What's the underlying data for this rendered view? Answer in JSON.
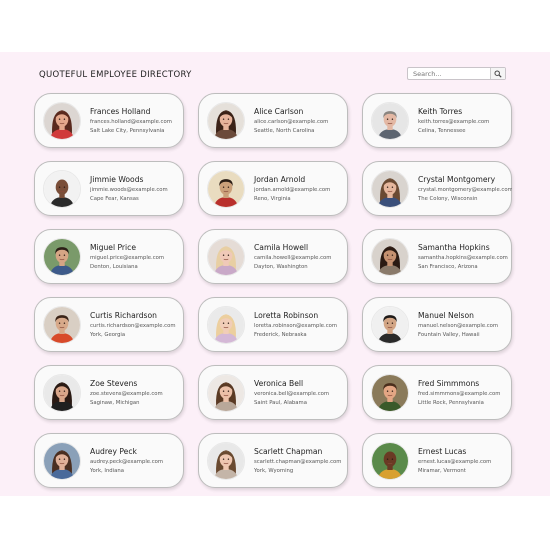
{
  "header": {
    "title": "QUOTEFUL EMPLOYEE DIRECTORY",
    "search_placeholder": "Search..."
  },
  "employees": [
    {
      "name": "Frances Holland",
      "email": "frances.holland@example.com",
      "location": "Salt Lake City, Pennsylvania",
      "skin": "#e4a88c",
      "hair": "#5a2a1e",
      "shirt": "#d03a3a",
      "bg": "#dcd6d2",
      "hairStyle": "long"
    },
    {
      "name": "Alice Carlson",
      "email": "alice.carlson@example.com",
      "location": "Seattle, North Carolina",
      "skin": "#e7b49c",
      "hair": "#3b2217",
      "shirt": "#6b4a3a",
      "bg": "#e5e0da",
      "hairStyle": "long"
    },
    {
      "name": "Keith Torres",
      "email": "keith.torres@example.com",
      "location": "Celina, Tennessee",
      "skin": "#e3b8a4",
      "hair": "#8a8580",
      "shirt": "#5d6570",
      "bg": "#e6e6e6",
      "hairStyle": "short"
    },
    {
      "name": "Jimmie Woods",
      "email": "jimmie.woods@example.com",
      "location": "Cape Fear, Kansas",
      "skin": "#7a4e38",
      "hair": "#2a1a12",
      "shirt": "#2a2a2a",
      "bg": "#f2f2f2",
      "hairStyle": "bald"
    },
    {
      "name": "Jordan Arnold",
      "email": "jordan.arnold@example.com",
      "location": "Reno, Virginia",
      "skin": "#caa07a",
      "hair": "#2a1d15",
      "shirt": "#b9302c",
      "bg": "#e9dcc0",
      "hairStyle": "short"
    },
    {
      "name": "Crystal Montgomery",
      "email": "crystal.montgomery@example.com",
      "location": "The Colony, Wisconsin",
      "skin": "#e5b79d",
      "hair": "#6a4a32",
      "shirt": "#3a4f7a",
      "bg": "#d9d4cf",
      "hairStyle": "long"
    },
    {
      "name": "Miguel Price",
      "email": "miguel.price@example.com",
      "location": "Denton, Louisiana",
      "skin": "#d6a585",
      "hair": "#2b1e16",
      "shirt": "#3d5a8a",
      "bg": "#7a9a6a",
      "hairStyle": "short"
    },
    {
      "name": "Camila Howell",
      "email": "camila.howell@example.com",
      "location": "Dayton, Washington",
      "skin": "#f0c9b8",
      "hair": "#e8cfa3",
      "shirt": "#c9a9c8",
      "bg": "#e5dcd6",
      "hairStyle": "long"
    },
    {
      "name": "Samantha Hopkins",
      "email": "samantha.hopkins@example.com",
      "location": "San Francisco, Arizona",
      "skin": "#c49170",
      "hair": "#2a1a12",
      "shirt": "#8a7a6a",
      "bg": "#d8d2cc",
      "hairStyle": "long"
    },
    {
      "name": "Curtis Richardson",
      "email": "curtis.richardson@example.com",
      "location": "York, Georgia",
      "skin": "#d7a98a",
      "hair": "#3a2418",
      "shirt": "#d84a2a",
      "bg": "#d9cfc4",
      "hairStyle": "short"
    },
    {
      "name": "Loretta Robinson",
      "email": "loretta.robinson@example.com",
      "location": "Frederick, Nebraska",
      "skin": "#f1cdb8",
      "hair": "#eccf9e",
      "shirt": "#d4b8d6",
      "bg": "#eaeaea",
      "hairStyle": "long"
    },
    {
      "name": "Manuel Nelson",
      "email": "manuel.nelson@example.com",
      "location": "Fountain Valley, Hawaii",
      "skin": "#d2a585",
      "hair": "#1e1a18",
      "shirt": "#2a2a2a",
      "bg": "#f0f0f0",
      "hairStyle": "short"
    },
    {
      "name": "Zoe Stevens",
      "email": "zoe.stevens@example.com",
      "location": "Saginaw, Michigan",
      "skin": "#d9a68a",
      "hair": "#2a1a14",
      "shirt": "#1f1f1f",
      "bg": "#e9e9e9",
      "hairStyle": "long"
    },
    {
      "name": "Veronica Bell",
      "email": "veronica.bell@example.com",
      "location": "Saint Paul, Alabama",
      "skin": "#ebc0a8",
      "hair": "#5a3a24",
      "shirt": "#b9a89a",
      "bg": "#ede8e4",
      "hairStyle": "long"
    },
    {
      "name": "Fred Simmmons",
      "email": "fred.simmmons@example.com",
      "location": "Little Rock, Pennsylvania",
      "skin": "#e3a684",
      "hair": "#4a2e1c",
      "shirt": "#3a5a2a",
      "bg": "#8a7a5a",
      "hairStyle": "short"
    },
    {
      "name": "Audrey Peck",
      "email": "audrey.peck@example.com",
      "location": "York, Indiana",
      "skin": "#e0b098",
      "hair": "#4a2e20",
      "shirt": "#4a6a9a",
      "bg": "#8aa0b8",
      "hairStyle": "long"
    },
    {
      "name": "Scarlett Chapman",
      "email": "scarlett.chapman@example.com",
      "location": "York, Wyoming",
      "skin": "#efc7b1",
      "hair": "#6a4a30",
      "shirt": "#c4b5a8",
      "bg": "#e8e8e8",
      "hairStyle": "long"
    },
    {
      "name": "Ernest Lucas",
      "email": "ernest.lucas@example.com",
      "location": "Miramar, Vermont",
      "skin": "#6a3a24",
      "hair": "#1a1210",
      "shirt": "#d8a030",
      "bg": "#5a8a4a",
      "hairStyle": "bald"
    }
  ]
}
